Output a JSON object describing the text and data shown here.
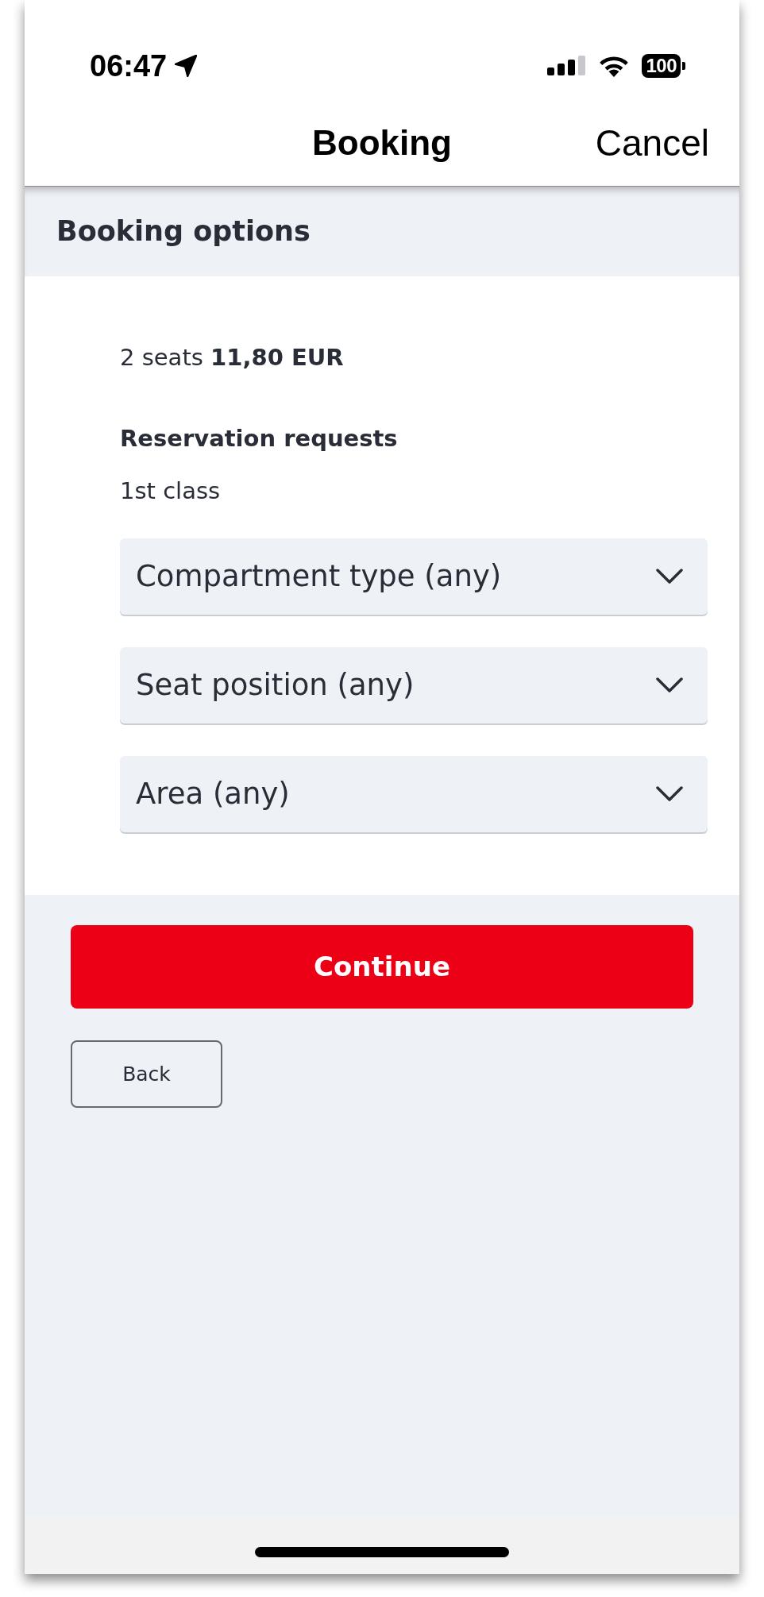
{
  "status_bar": {
    "time": "06:47",
    "battery": "100"
  },
  "nav_bar": {
    "title": "Booking",
    "action": "Cancel"
  },
  "section": {
    "title": "Booking options"
  },
  "summary": "2 seats **11,80 EUR**",
  "reservation": {
    "heading": "Reservation requests",
    "travel_class": "1st class",
    "dropdowns": [
      {
        "label": "Compartment type (any)"
      },
      {
        "label": "Seat position (any)"
      },
      {
        "label": "Area (any)"
      }
    ]
  },
  "buttons": [
    {
      "kind": "primary",
      "label": "Continue"
    },
    {
      "kind": "secondary",
      "label": "Back"
    }
  ]
}
